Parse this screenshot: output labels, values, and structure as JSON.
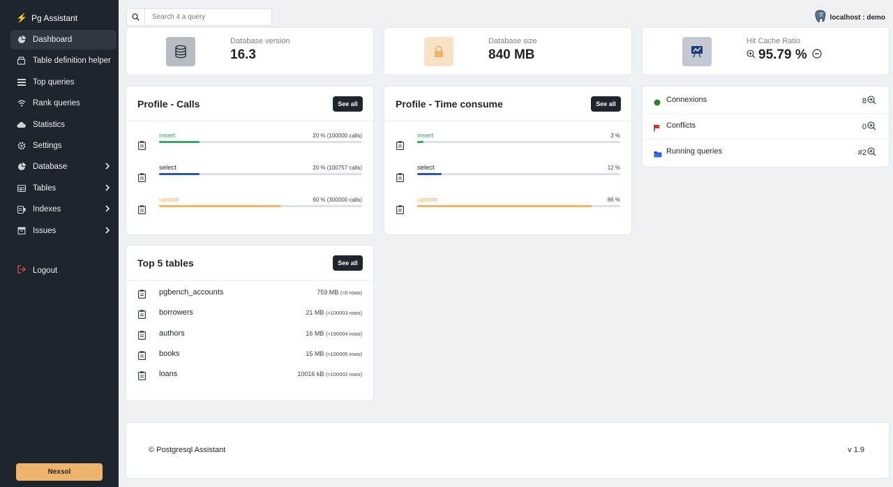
{
  "app": {
    "title": "Pg Assistant"
  },
  "sidebar": {
    "items": [
      {
        "label": "Dashboard"
      },
      {
        "label": "Table definition helper"
      },
      {
        "label": "Top queries"
      },
      {
        "label": "Rank queries"
      },
      {
        "label": "Statistics"
      },
      {
        "label": "Settings"
      },
      {
        "label": "Database"
      },
      {
        "label": "Tables"
      },
      {
        "label": "Indexes"
      },
      {
        "label": "Issues"
      }
    ],
    "logout": "Logout",
    "company_button": "Nexsol"
  },
  "search": {
    "placeholder": "Search 4 a query"
  },
  "user": {
    "label": "localhost : demo"
  },
  "stats": {
    "db_version": {
      "label": "Database version",
      "value": "16.3"
    },
    "db_size": {
      "label": "Database size",
      "value": "840 MB"
    },
    "hit_cache": {
      "label": "Hit Cache Ratio",
      "value": "95.79 %"
    }
  },
  "profile_calls": {
    "title": "Profile - Calls",
    "see_all": "See all",
    "rows": [
      {
        "name": "insert",
        "value": "20 % (100000 calls)",
        "percent": 20
      },
      {
        "name": "select",
        "value": "20 % (100757 calls)",
        "percent": 20
      },
      {
        "name": "update",
        "value": "60 % (300000 calls)",
        "percent": 60
      }
    ]
  },
  "profile_time": {
    "title": "Profile - Time consume",
    "see_all": "See all",
    "rows": [
      {
        "name": "insert",
        "value": "3 %",
        "percent": 3
      },
      {
        "name": "select",
        "value": "12 %",
        "percent": 12
      },
      {
        "name": "update",
        "value": "86 %",
        "percent": 86
      }
    ]
  },
  "top_tables": {
    "title": "Top 5 tables",
    "see_all": "See all",
    "rows": [
      {
        "name": "pgbench_accounts",
        "size": "759 MB",
        "rows": "(≈0 rows)"
      },
      {
        "name": "borrowers",
        "size": "21 MB",
        "rows": "(≈100003 rows)"
      },
      {
        "name": "authors",
        "size": "16 MB",
        "rows": "(≈190004 rows)"
      },
      {
        "name": "books",
        "size": "15 MB",
        "rows": "(≈100005 rows)"
      },
      {
        "name": "loans",
        "size": "10016 kB",
        "rows": "(≈100002 rows)"
      }
    ]
  },
  "server_status": {
    "rows": [
      {
        "label": "Connexions",
        "value": "8"
      },
      {
        "label": "Conflicts",
        "value": "0"
      },
      {
        "label": "Running queries",
        "value": "#2"
      }
    ]
  },
  "footer": {
    "copyright": "© Postgresql Assistant",
    "version": "v 1.9"
  },
  "colors": {
    "sidebar_bg": "#1f252d",
    "insert": "#3aa56b",
    "select": "#2b56a8",
    "update": "#efb46c",
    "accent": "#efb46c"
  }
}
